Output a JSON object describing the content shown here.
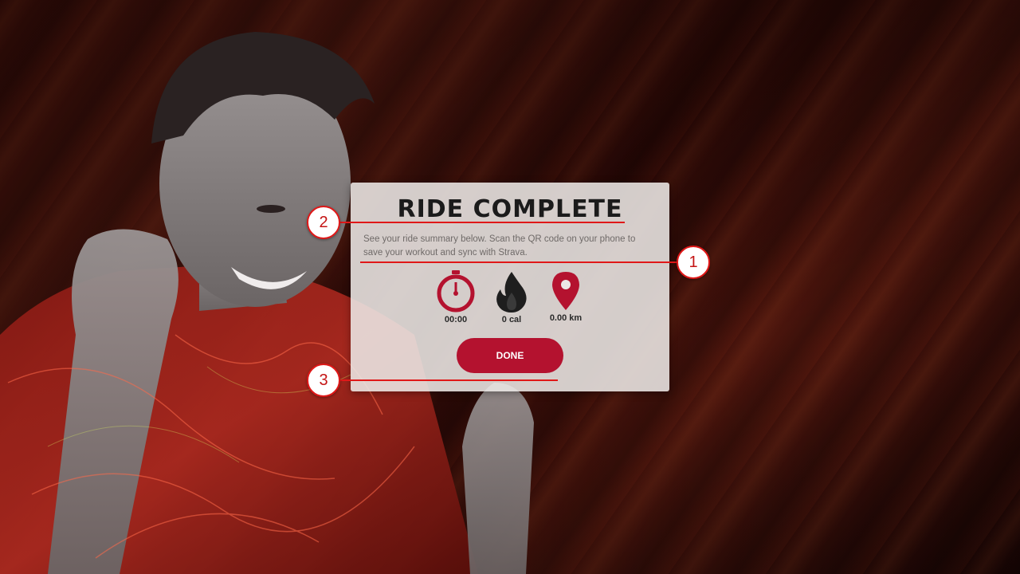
{
  "modal": {
    "title": "RIDE COMPLETE",
    "description": "See your ride summary below. Scan the QR code on your phone to save your workout and sync with Strava.",
    "stats": [
      {
        "icon": "stopwatch-icon",
        "value": "00:00"
      },
      {
        "icon": "flame-icon",
        "value": "0 cal"
      },
      {
        "icon": "location-pin-icon",
        "value": "0.00 km"
      }
    ],
    "done_label": "DONE"
  },
  "annotations": [
    {
      "number": "1"
    },
    {
      "number": "2"
    },
    {
      "number": "3"
    }
  ],
  "colors": {
    "accent": "#b4122f",
    "callout": "#e01818",
    "modal_bg": "#ece8e6"
  }
}
